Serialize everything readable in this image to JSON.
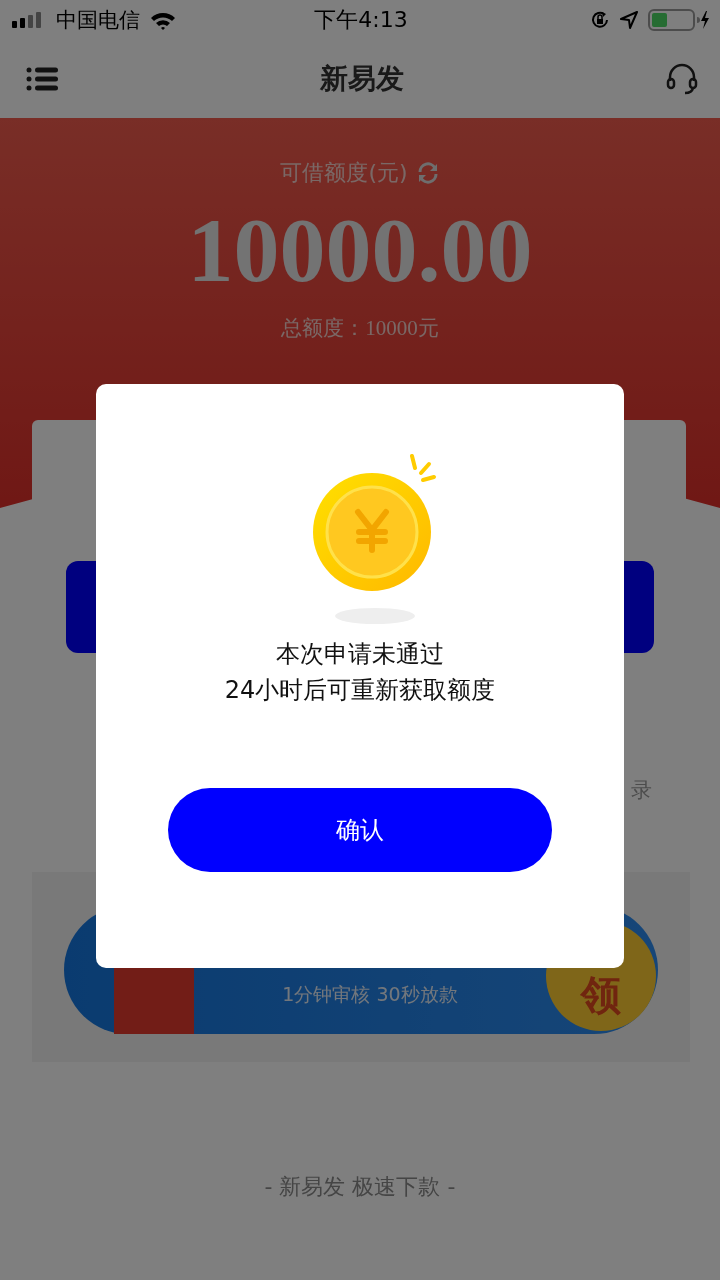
{
  "status_bar": {
    "carrier": "中国电信",
    "time": "下午4:13"
  },
  "header": {
    "title": "新易发"
  },
  "credit": {
    "label": "可借额度(元)",
    "amount": "10000.00",
    "total": "总额度：10000元"
  },
  "card": {
    "shortcut_label": "录"
  },
  "banner": {
    "tagline": "1分钟审核 30秒放款",
    "badge": "领"
  },
  "footer": "- 新易发 极速下款 -",
  "dialog": {
    "line1": "本次申请未通过",
    "line2": "24小时后可重新获取额度",
    "button": "确认"
  }
}
